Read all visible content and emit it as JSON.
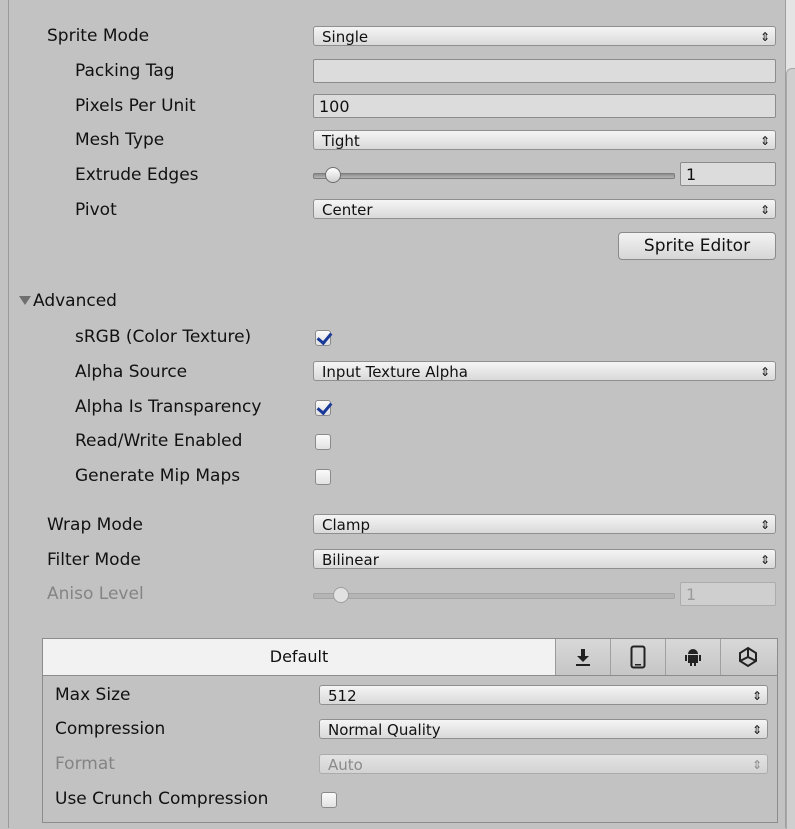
{
  "sprite": {
    "sprite_mode": {
      "label": "Sprite Mode",
      "value": "Single"
    },
    "packing_tag": {
      "label": "Packing Tag",
      "value": ""
    },
    "pixels_per_unit": {
      "label": "Pixels Per Unit",
      "value": "100"
    },
    "mesh_type": {
      "label": "Mesh Type",
      "value": "Tight"
    },
    "extrude_edges": {
      "label": "Extrude Edges",
      "value": "1"
    },
    "pivot": {
      "label": "Pivot",
      "value": "Center"
    },
    "sprite_editor_label": "Sprite Editor"
  },
  "advanced": {
    "label": "Advanced",
    "expanded": true,
    "srgb": {
      "label": "sRGB (Color Texture)",
      "checked": true
    },
    "alpha_source": {
      "label": "Alpha Source",
      "value": "Input Texture Alpha"
    },
    "alpha_is_transparency": {
      "label": "Alpha Is Transparency",
      "checked": true
    },
    "read_write": {
      "label": "Read/Write Enabled",
      "checked": false
    },
    "generate_mip_maps": {
      "label": "Generate Mip Maps",
      "checked": false
    }
  },
  "wrap_mode": {
    "label": "Wrap Mode",
    "value": "Clamp"
  },
  "filter_mode": {
    "label": "Filter Mode",
    "value": "Bilinear"
  },
  "aniso_level": {
    "label": "Aniso Level",
    "value": "1",
    "enabled": false
  },
  "platform": {
    "tabs": [
      {
        "label": "Default",
        "selected": true
      },
      {
        "icon": "download-icon"
      },
      {
        "icon": "mobile-icon"
      },
      {
        "icon": "android-icon"
      },
      {
        "icon": "unity-webgl-icon"
      }
    ],
    "max_size": {
      "label": "Max Size",
      "value": "512"
    },
    "compression": {
      "label": "Compression",
      "value": "Normal Quality"
    },
    "format": {
      "label": "Format",
      "value": "Auto",
      "enabled": false
    },
    "use_crunch": {
      "label": "Use Crunch Compression",
      "checked": false
    }
  },
  "colors": {
    "panel_bg": "#c2c2c2",
    "check_color": "#1a3a9a",
    "disabled_text": "#848484"
  }
}
